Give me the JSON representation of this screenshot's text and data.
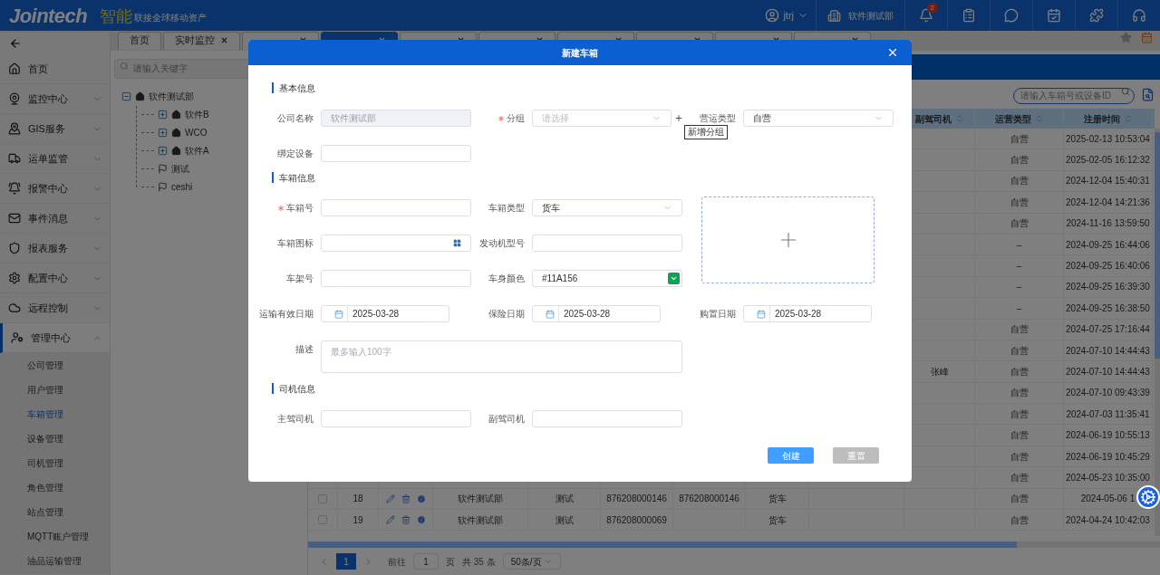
{
  "header": {
    "logo": "Jointech",
    "slogan_mark": "智能",
    "slogan": "联接全球移动资产",
    "user": "jtrj",
    "department": "软件测试部",
    "notifications": "2"
  },
  "sidebar": {
    "items": [
      {
        "label": "首页",
        "expandable": false,
        "selected": false
      },
      {
        "label": "监控中心",
        "expandable": true,
        "expanded": false,
        "selected": false
      },
      {
        "label": "GIS服务",
        "expandable": true,
        "expanded": false,
        "selected": false
      },
      {
        "label": "运单监管",
        "expandable": true,
        "expanded": false,
        "selected": false
      },
      {
        "label": "报警中心",
        "expandable": true,
        "expanded": false,
        "selected": false
      },
      {
        "label": "事件消息",
        "expandable": true,
        "expanded": false,
        "selected": false
      },
      {
        "label": "报表服务",
        "expandable": true,
        "expanded": false,
        "selected": false
      },
      {
        "label": "配置中心",
        "expandable": true,
        "expanded": false,
        "selected": false
      },
      {
        "label": "远程控制",
        "expandable": true,
        "expanded": false,
        "selected": false
      },
      {
        "label": "管理中心",
        "expandable": true,
        "expanded": true,
        "selected": true,
        "children": [
          {
            "label": "公司管理",
            "selected": false
          },
          {
            "label": "用户管理",
            "selected": false
          },
          {
            "label": "车箱管理",
            "selected": true
          },
          {
            "label": "设备管理",
            "selected": false
          },
          {
            "label": "司机管理",
            "selected": false
          },
          {
            "label": "角色管理",
            "selected": false
          },
          {
            "label": "站点管理",
            "selected": false
          },
          {
            "label": "MQTT账户管理",
            "selected": false
          },
          {
            "label": "油品运输管理",
            "selected": false
          }
        ]
      }
    ]
  },
  "tabs": [
    {
      "label": "首页",
      "selected": false,
      "closable": false
    },
    {
      "label": "实时监控",
      "selected": false,
      "closable": true
    },
    {
      "selected": false,
      "closable": true
    },
    {
      "selected": true,
      "closable": true
    },
    {
      "selected": false,
      "closable": true
    },
    {
      "selected": false,
      "closable": true
    },
    {
      "selected": false,
      "closable": true
    },
    {
      "selected": false,
      "closable": true
    },
    {
      "selected": false,
      "closable": true
    },
    {
      "selected": false,
      "closable": true
    }
  ],
  "tree": {
    "search_placeholder": "请输入关键字",
    "nodes": [
      {
        "label": "软件测试部",
        "kind": "company",
        "expanded": true,
        "children": [
          {
            "label": "软件B",
            "kind": "company",
            "expanded": false
          },
          {
            "label": "WCO",
            "kind": "company",
            "expanded": false
          },
          {
            "label": "软件A",
            "kind": "company",
            "expanded": false
          },
          {
            "label": "测试",
            "kind": "group"
          },
          {
            "label": "ceshi",
            "kind": "group"
          }
        ]
      }
    ]
  },
  "toolbar": {
    "search_placeholder": "请输入车箱号或设备ID"
  },
  "table": {
    "columns": [
      {
        "label": "副驾司机"
      },
      {
        "label": "运营类型"
      },
      {
        "label": "注册时间"
      }
    ],
    "rows": [
      {
        "op_type": "自营",
        "reg_time": "2025-02-13 10:53:04"
      },
      {
        "op_type": "自营",
        "reg_time": "2025-02-05 16:12:32"
      },
      {
        "op_type": "自营",
        "reg_time": "2024-12-04 15:40:31"
      },
      {
        "op_type": "自营",
        "reg_time": "2024-12-04 14:21:36"
      },
      {
        "op_type": "自营",
        "reg_time": "2024-11-16 13:59:50"
      },
      {
        "op_type": "–",
        "reg_time": "2024-09-25 16:44:06"
      },
      {
        "op_type": "–",
        "reg_time": "2024-09-25 16:40:06"
      },
      {
        "op_type": "–",
        "reg_time": "2024-09-25 16:39:30"
      },
      {
        "op_type": "–",
        "reg_time": "2024-09-25 16:38:50"
      },
      {
        "op_type": "自营",
        "reg_time": "2024-07-25 17:16:44"
      },
      {
        "op_type": "自营",
        "reg_time": "2024-07-10 14:44:43"
      },
      {
        "co_driver": "张峰",
        "op_type": "自营",
        "reg_time": "2024-07-10 14:44:43"
      },
      {
        "op_type": "自营",
        "reg_time": "2024-07-10 09:43:39"
      },
      {
        "op_type": "自营",
        "reg_time": "2024-07-03 11:35:41"
      },
      {
        "op_type": "自营",
        "reg_time": "2024-06-19 10:55:13"
      },
      {
        "op_type": "自营",
        "reg_time": "2024-06-19 10:45:29"
      },
      {
        "op_type": "自营",
        "reg_time": "2024-05-23 10:35:00"
      },
      {
        "checked": false,
        "index": "18",
        "company": "软件测试部",
        "group": "测试",
        "box_no": "876208000146",
        "device_id": "876208000146",
        "box_type": "货车",
        "op_type": "自营",
        "reg_time": "2024-05-06 1"
      },
      {
        "checked": false,
        "index": "19",
        "company": "软件测试部",
        "group": "测试",
        "box_no": "876208000069",
        "box_type": "货车",
        "op_type": "自营",
        "reg_time": "2024-04-24 10:42:03"
      }
    ]
  },
  "pagination": {
    "pages": [
      {
        "label": "1",
        "selected": true
      }
    ],
    "goto_label": "前往",
    "goto_value": "1",
    "page_unit": "页",
    "total": "共 35 条",
    "page_size": "50条/页"
  },
  "modal": {
    "title": "新建车箱",
    "sections": [
      {
        "title": "基本信息",
        "fields": [
          {
            "kind": "input",
            "label": "公司名称",
            "required": false,
            "disabled": true,
            "value": "软件测试部"
          },
          {
            "kind": "select",
            "label": "分组",
            "required": true,
            "placeholder": "请选择",
            "add_tooltip": "新增分组"
          },
          {
            "kind": "select",
            "label": "营运类型",
            "required": false,
            "value": "自营"
          },
          {
            "kind": "input",
            "label": "绑定设备",
            "required": false,
            "disabled": false
          }
        ]
      },
      {
        "title": "车箱信息",
        "fields": [
          {
            "kind": "input",
            "label": "车箱号",
            "required": true,
            "disabled": false
          },
          {
            "kind": "select",
            "label": "车箱类型",
            "required": false,
            "value": "货车"
          },
          {
            "kind": "upload"
          },
          {
            "kind": "icon_picker",
            "label": "车箱图标",
            "required": false
          },
          {
            "kind": "input",
            "label": "发动机型号",
            "required": false,
            "disabled": false
          },
          {
            "kind": "input",
            "label": "车架号",
            "required": false,
            "disabled": false
          },
          {
            "kind": "color",
            "label": "车身颜色",
            "required": false,
            "value": "#11A156",
            "color": "#11a156"
          },
          {
            "kind": "date",
            "label": "运输有效日期",
            "required": false,
            "value": "2025-03-28"
          },
          {
            "kind": "date",
            "label": "保险日期",
            "required": false,
            "value": "2025-03-28"
          },
          {
            "kind": "date",
            "label": "购置日期",
            "required": false,
            "value": "2025-03-28"
          },
          {
            "kind": "textarea",
            "label": "描述",
            "required": false,
            "placeholder": "最多输入100字"
          }
        ]
      },
      {
        "title": "司机信息",
        "fields": [
          {
            "kind": "input",
            "label": "主驾司机",
            "required": false,
            "disabled": false
          },
          {
            "kind": "input",
            "label": "副驾司机",
            "required": false,
            "disabled": false
          }
        ]
      }
    ],
    "buttons": [
      {
        "label": "创建",
        "kind": "primary"
      },
      {
        "label": "重置",
        "kind": "secondary"
      }
    ]
  }
}
